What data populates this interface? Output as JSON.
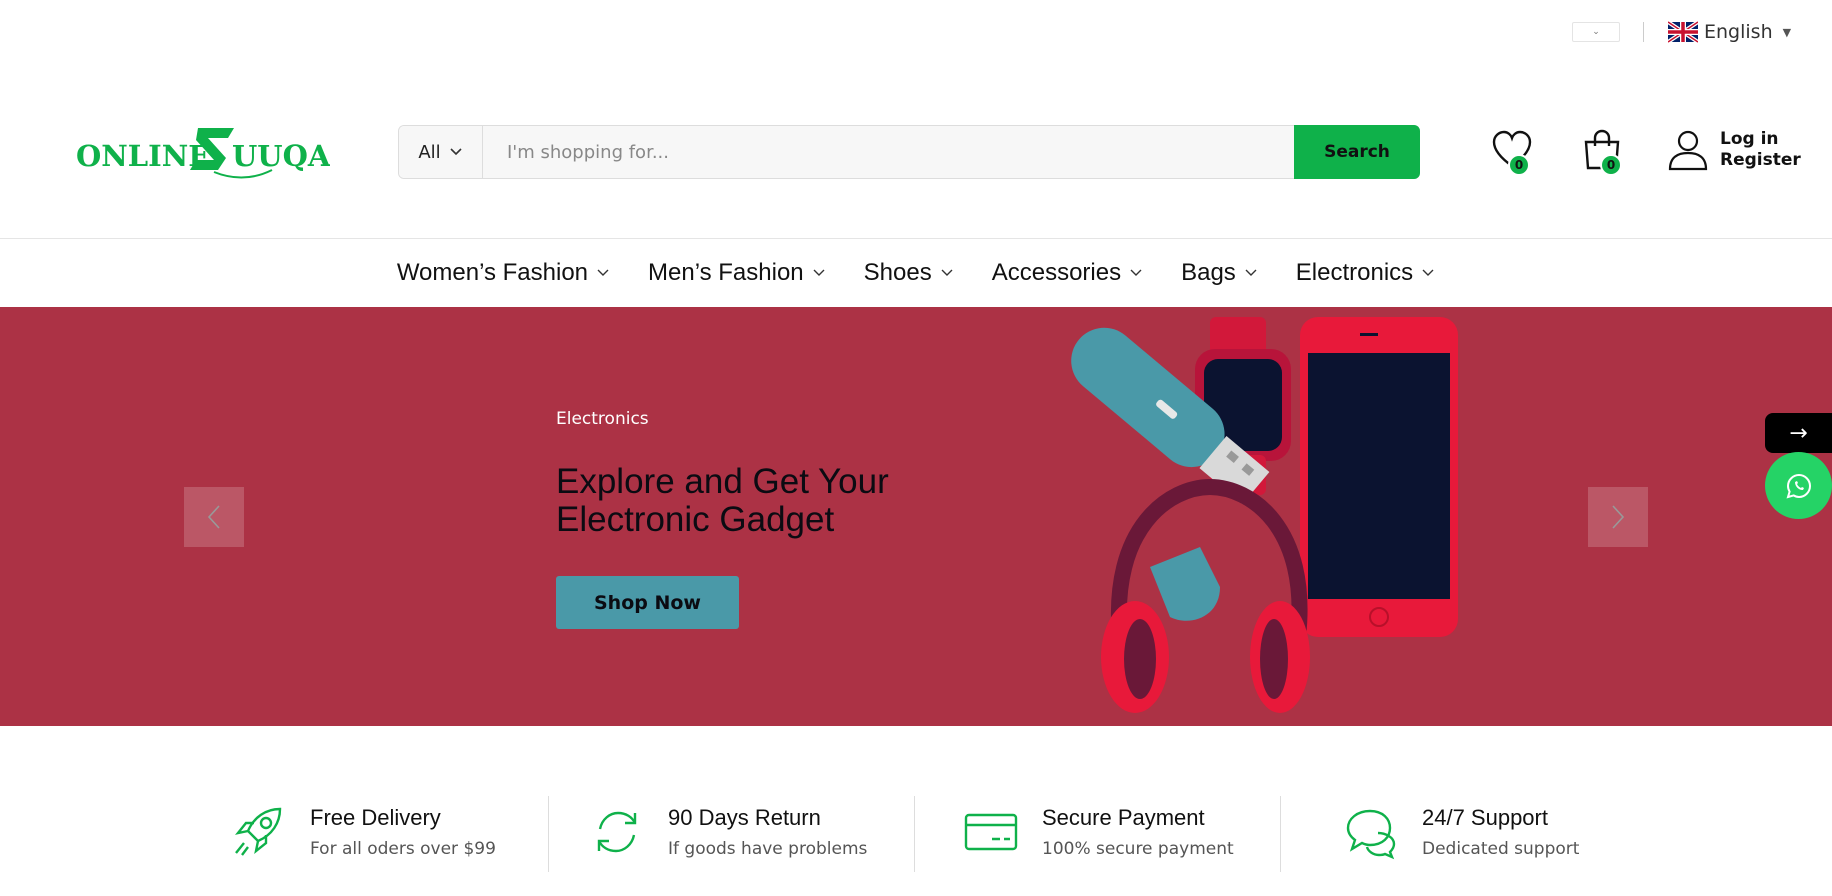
{
  "topbar": {
    "language": "English",
    "currency_caret": "⌄"
  },
  "header": {
    "logo_text_left": "ONLINE",
    "logo_text_right": "UUQA",
    "search": {
      "category": "All",
      "placeholder": "I'm shopping for...",
      "button": "Search"
    },
    "wishlist_count": "0",
    "cart_count": "0",
    "login": "Log in",
    "register": "Register"
  },
  "nav": {
    "items": [
      {
        "label": "Women’s Fashion"
      },
      {
        "label": "Men’s Fashion"
      },
      {
        "label": "Shoes"
      },
      {
        "label": "Accessories"
      },
      {
        "label": "Bags"
      },
      {
        "label": "Electronics"
      }
    ]
  },
  "hero": {
    "eyebrow": "Electronics",
    "headline": "Explore and Get Your Electronic Gadget",
    "cta": "Shop Now",
    "background": "#ac3245"
  },
  "floating": {
    "arrow": "→"
  },
  "features": [
    {
      "title": "Free Delivery",
      "subtitle": "For all oders over $99",
      "icon": "rocket-icon"
    },
    {
      "title": "90 Days Return",
      "subtitle": "If goods have problems",
      "icon": "refresh-icon"
    },
    {
      "title": "Secure Payment",
      "subtitle": "100% secure payment",
      "icon": "credit-card-icon"
    },
    {
      "title": "24/7 Support",
      "subtitle": "Dedicated support",
      "icon": "chat-bubbles-icon"
    }
  ],
  "colors": {
    "brand_green": "#0fb14a",
    "hero_bg": "#ac3245",
    "cta_bg": "#4a99a8"
  }
}
